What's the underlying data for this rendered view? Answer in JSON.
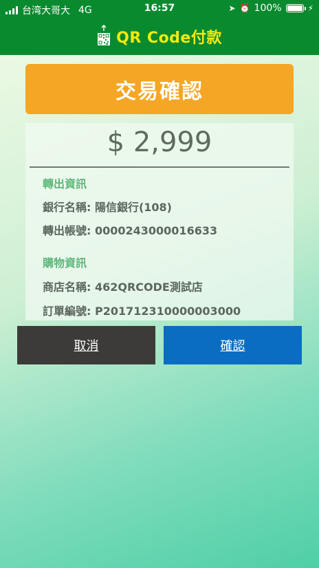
{
  "status_bar": {
    "carrier": "台湾大哥大",
    "network": "4G",
    "time": "16:57",
    "battery": "100%"
  },
  "nav": {
    "title": "QR Code付款",
    "icon": "qr-code-icon",
    "color": "#f3ea12"
  },
  "banner": {
    "title": "交易確認",
    "color": "#f4a624"
  },
  "transaction": {
    "amount": "$ 2,999",
    "transfer_section": {
      "title": "轉出資訊",
      "bank_name": "銀行名稱: 陽信銀行(108)",
      "account": "轉出帳號: 0000243000016633"
    },
    "shopping_section": {
      "title": "購物資訊",
      "store_name": "商店名稱: 462QRCODE測試店",
      "order_no": "訂單編號: P20171231000000300​0"
    }
  },
  "buttons": {
    "cancel": "取消",
    "confirm": "確認"
  }
}
